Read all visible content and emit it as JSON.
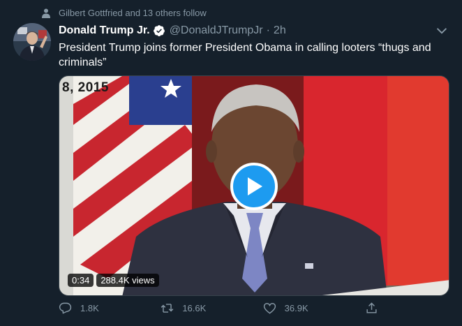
{
  "social_context": {
    "text": "Gilbert Gottfried and 13 others follow"
  },
  "tweet": {
    "author_name": "Donald Trump Jr.",
    "handle": "@DonaldJTrumpJr",
    "separator": "·",
    "time": "2h",
    "text": "President Trump joins former President Obama in calling looters “thugs and criminals”"
  },
  "media": {
    "date_text": "8, 2015",
    "duration": "0:34",
    "views": "288.4K views",
    "type": "video"
  },
  "actions": {
    "reply_count": "1.8K",
    "retweet_count": "16.6K",
    "like_count": "36.9K"
  },
  "colors": {
    "background": "#15202b",
    "secondary_text": "#8899a6",
    "accent": "#1d9bf0",
    "border": "#38444d"
  },
  "icons": {
    "social": "person-icon",
    "verified": "verified-icon",
    "more": "chevron-down-icon",
    "play": "play-icon",
    "reply": "reply-icon",
    "retweet": "retweet-icon",
    "like": "heart-icon",
    "share": "share-icon"
  }
}
